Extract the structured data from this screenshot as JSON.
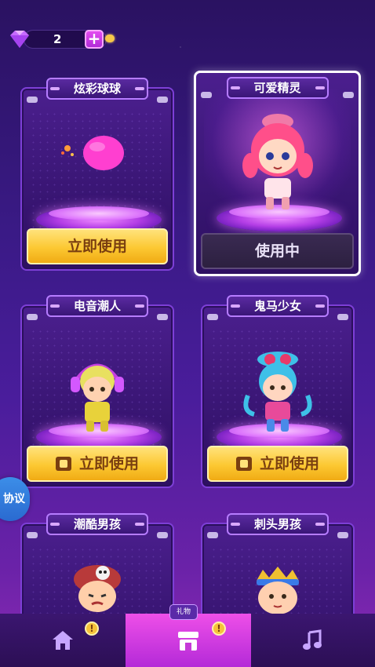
{
  "topbar": {
    "gem_count": "2",
    "plus_label": "+"
  },
  "cards": [
    {
      "title": "炫彩球球",
      "action": "立即使用",
      "state": "available",
      "ad_required": false
    },
    {
      "title": "可爱精灵",
      "action": "使用中",
      "state": "in_use",
      "ad_required": false
    },
    {
      "title": "电音潮人",
      "action": "立即使用",
      "state": "available",
      "ad_required": true
    },
    {
      "title": "鬼马少女",
      "action": "立即使用",
      "state": "available",
      "ad_required": true
    },
    {
      "title": "潮酷男孩",
      "action": "",
      "state": "partial",
      "ad_required": false
    },
    {
      "title": "刺头男孩",
      "action": "",
      "state": "partial",
      "ad_required": false
    }
  ],
  "side_pill": {
    "label": "协议"
  },
  "bottom_nav": {
    "tabs": [
      {
        "name": "home",
        "icon": "home-icon",
        "badge": "!"
      },
      {
        "name": "shop",
        "icon": "shop-icon",
        "badge": "!",
        "tag": "礼物"
      },
      {
        "name": "music",
        "icon": "music-note-icon"
      }
    ],
    "active": "shop"
  },
  "colors": {
    "accent_pink": "#ee4fe8",
    "button_gold": "#fcc832",
    "card_border": "#7d3fd6"
  }
}
